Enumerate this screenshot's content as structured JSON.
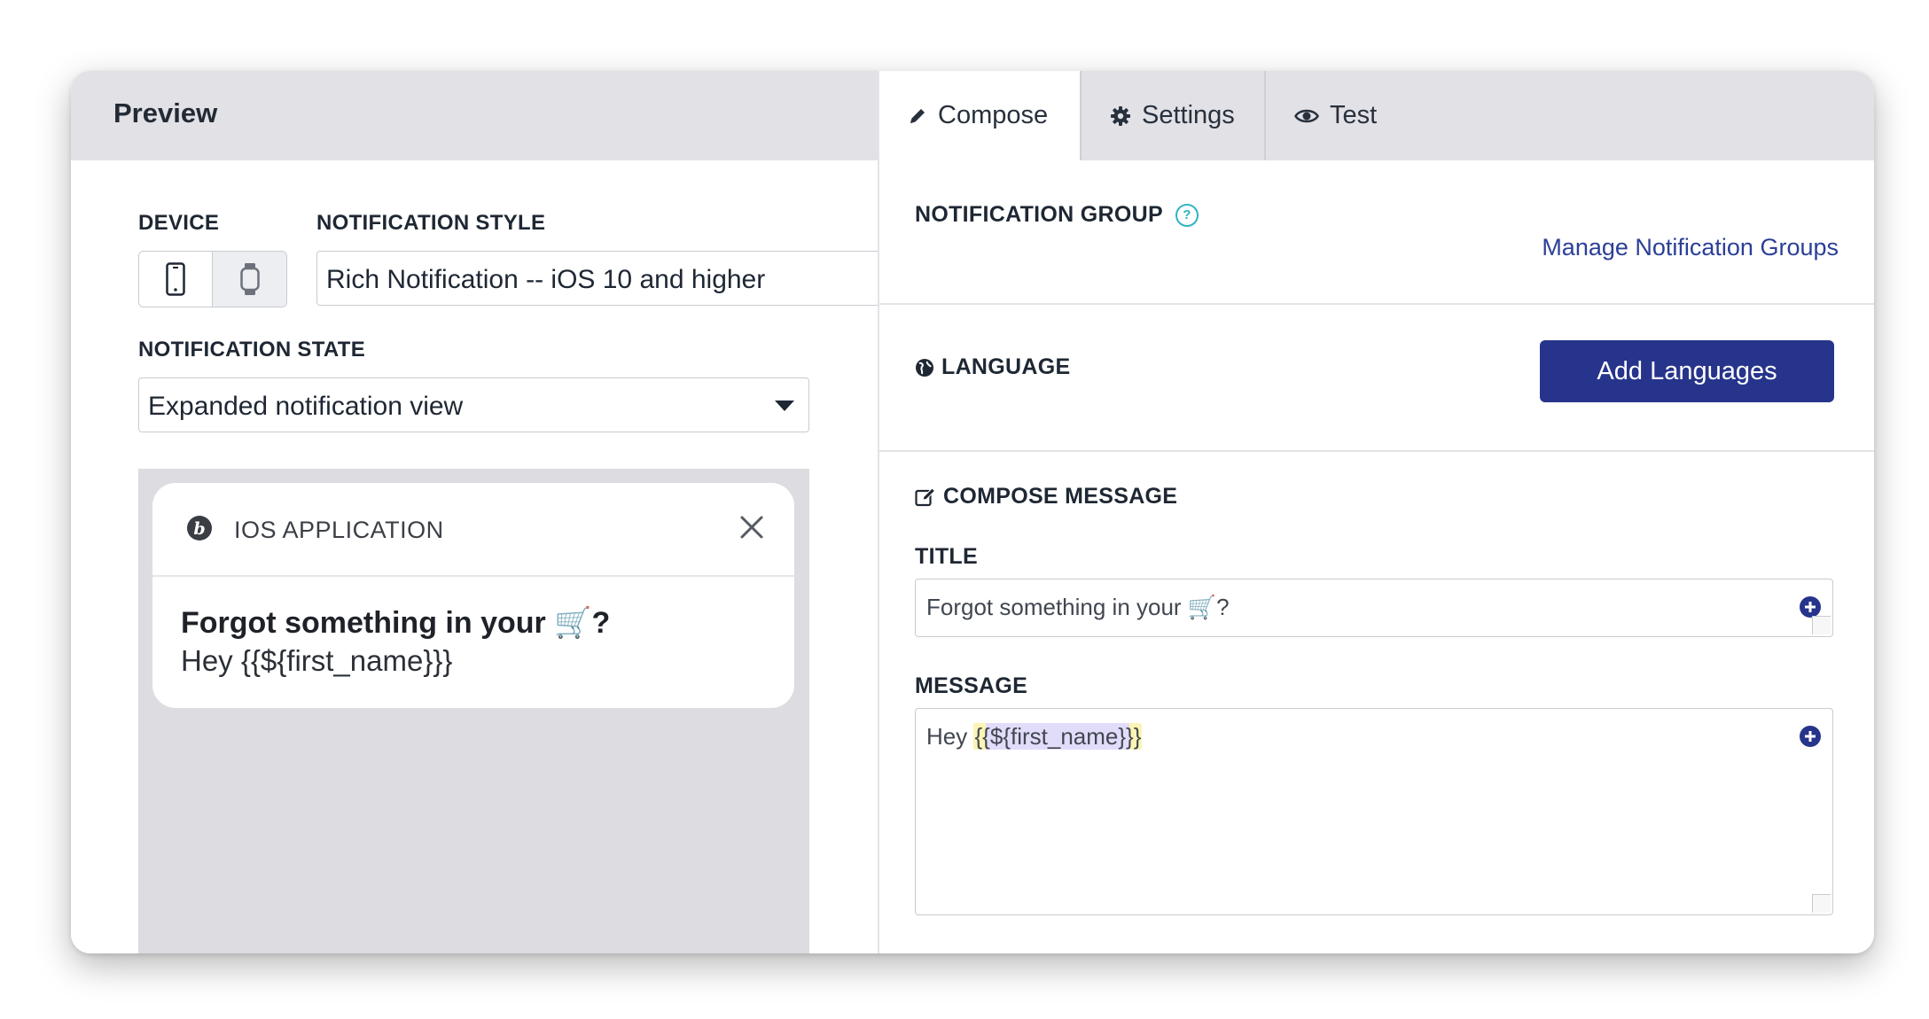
{
  "preview": {
    "header_title": "Preview",
    "device_label": "DEVICE",
    "style_label": "NOTIFICATION STYLE",
    "style_value": "Rich Notification -- iOS 10 and higher",
    "state_label": "NOTIFICATION STATE",
    "state_value": "Expanded notification view",
    "notification": {
      "app_name": "IOS APPLICATION",
      "title": "Forgot something in your 🛒?",
      "body": "Hey {{${first_name}}}"
    }
  },
  "tabs": [
    {
      "label": "Compose",
      "icon": "pencil-icon",
      "active": true
    },
    {
      "label": "Settings",
      "icon": "gear-icon",
      "active": false
    },
    {
      "label": "Test",
      "icon": "eye-icon",
      "active": false
    }
  ],
  "compose": {
    "notification_group_label": "NOTIFICATION GROUP",
    "manage_groups_link": "Manage Notification Groups",
    "language_label": "LANGUAGE",
    "add_languages_button": "Add Languages",
    "compose_message_label": "COMPOSE MESSAGE",
    "title_label": "TITLE",
    "title_value": "Forgot something in your 🛒?",
    "message_label": "MESSAGE",
    "message_prefix": "Hey ",
    "message_variable": "{{${first_name}}}"
  },
  "colors": {
    "accent": "#27348b",
    "link": "#2b3f97",
    "help": "#31b3c3",
    "header_bg": "#e1e1e6"
  }
}
